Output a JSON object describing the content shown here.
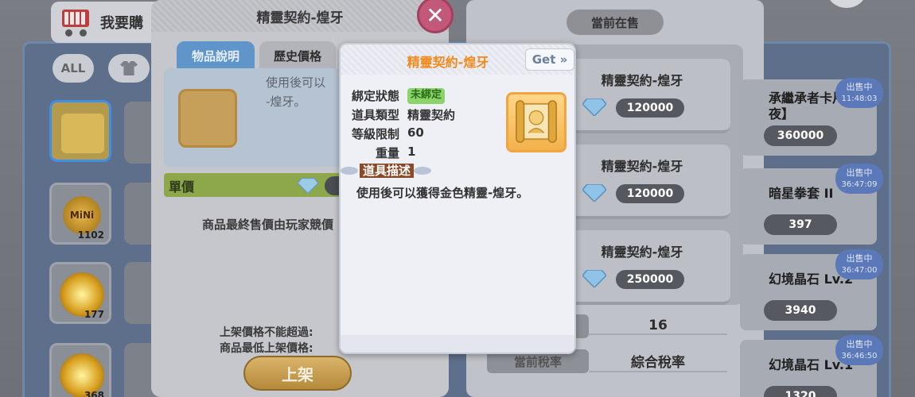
{
  "background": {
    "header_label": "我要購",
    "filter_all": "ALL",
    "items": [
      {
        "qty": ""
      },
      {
        "qty": "1102",
        "coin_text": "MiNi"
      },
      {
        "qty": "177"
      },
      {
        "qty": "368"
      }
    ]
  },
  "sell_dialog": {
    "title": "精靈契約-煌牙",
    "tabs": [
      "物品說明",
      "歷史價格"
    ],
    "desc_line1": "使用後可以",
    "desc_line2": "-煌牙。",
    "unit_price_label": "單價",
    "final_note": "商品最終售價由玩家競價",
    "rule1": "上架價格不能超過:",
    "rule2": "商品最低上架價格:",
    "list_button": "上架",
    "close_symbol": "✕"
  },
  "tooltip": {
    "title": "精靈契約-煌牙",
    "get_button": "Get »",
    "bind_key": "綁定狀態",
    "bind_value": "未綁定",
    "type_key": "道具類型",
    "type_value": "精靈契約",
    "level_key": "等級限制",
    "level_value": "60",
    "weight_key": "重量",
    "weight_value": "1",
    "section_label": "道具描述",
    "description": "使用後可以獲得金色精靈-煌牙。"
  },
  "right_panel": {
    "tab_label": "當前在售",
    "listings": [
      {
        "name": "精靈契約-煌牙",
        "price": "120000"
      },
      {
        "name": "精靈契約-煌牙",
        "price": "120000"
      },
      {
        "name": "精靈契約-煌牙",
        "price": "250000"
      }
    ],
    "stat1_value": "16",
    "stat2_label": "當前稅率",
    "stat2_value": "綜合稅率"
  },
  "sale_list": [
    {
      "title_line1": "承繼承者卡片",
      "title_line2": "夜】",
      "value": "360000",
      "badge_status": "出售中",
      "badge_time": "11:48:03"
    },
    {
      "title_line1": "暗星拳套 II",
      "title_line2": "",
      "value": "397",
      "badge_status": "出售中",
      "badge_time": "36:47:09"
    },
    {
      "title_line1": "幻境晶石 Lv.2",
      "title_line2": "",
      "value": "3940",
      "badge_status": "出售中",
      "badge_time": "36:47:00"
    },
    {
      "title_line1": "幻境晶石 Lv.1",
      "title_line2": "",
      "value": "1320",
      "badge_status": "出售中",
      "badge_time": "36:46:50"
    }
  ],
  "colors": {
    "tooltip_title": "#f08a1c",
    "bind_badge": "#8bd46a",
    "section_label_bg": "#8a4a2a"
  }
}
